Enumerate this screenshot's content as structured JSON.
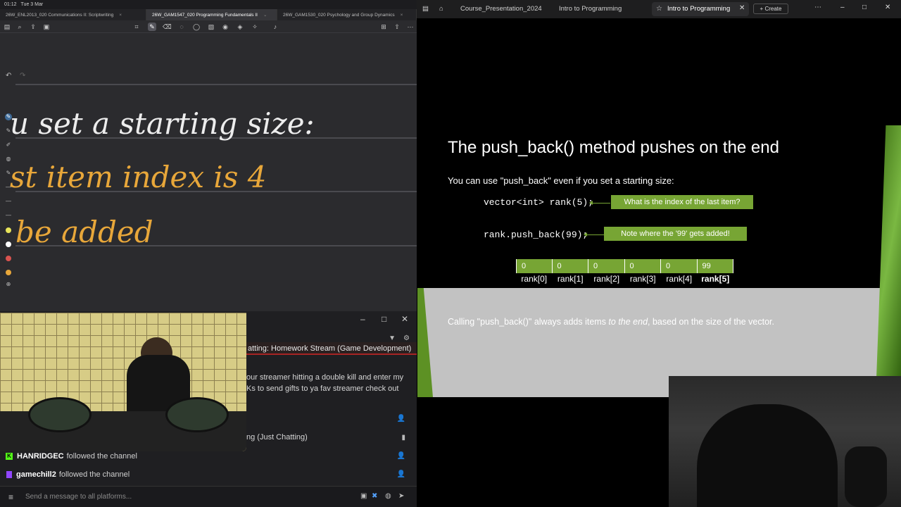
{
  "status": {
    "time": "01:12",
    "date": "Tue 3 Mar"
  },
  "notebook": {
    "tabs": [
      {
        "label": "26W_ENL2013_020 Communications II: Scriptwriting"
      },
      {
        "label": "26W_GAM1547_020 Programming Fundamentals II",
        "active": true
      },
      {
        "label": "26W_GAM1530_020 Psychology and Group Dynamics"
      }
    ],
    "handwriting": [
      {
        "text": "u set a starting size:",
        "color": "white"
      },
      {
        "text": "st item index is 4",
        "color": "orange"
      },
      {
        "text": "be added",
        "color": "orange"
      }
    ]
  },
  "chat": {
    "banner": "atting: Homework Stream (Game Development)",
    "lines": [
      "our streamer hitting a double kill and enter my",
      "Ks to send gifts to ya fav streamer check out",
      "ng (Just Chatting)"
    ],
    "follows": [
      {
        "name": "HANRIDGEC",
        "action": "followed the channel",
        "platform": "kick"
      },
      {
        "name": "gamechill2",
        "action": "followed the channel",
        "platform": "twitch"
      }
    ],
    "input_placeholder": "Send a message to all platforms..."
  },
  "browser": {
    "tabs": [
      {
        "label": "Course_Presentation_2024"
      },
      {
        "label": "Intro to Programming"
      },
      {
        "label": "Intro to Programming",
        "active": true
      }
    ],
    "create_label": "+ Create"
  },
  "slide": {
    "title": "The push_back() method pushes on the end",
    "subtitle": "You can use \"push_back\" even if you set a starting size:",
    "code1": "vector<int> rank(5);",
    "callout1": "What is the index of the last item?",
    "code2": "rank.push_back(99);",
    "callout2": "Note where the '99' gets added!",
    "cells": [
      "0",
      "0",
      "0",
      "0",
      "0",
      "99"
    ],
    "labels": [
      "rank[0]",
      "rank[1]",
      "rank[2]",
      "rank[3]",
      "rank[4]",
      "rank[5]"
    ],
    "note_pre": "Calling \"push_back()\" always adds items ",
    "note_em": "to the end",
    "note_post": ", based on the size of the vector."
  },
  "colors": {
    "accent_green": "#77a534",
    "handwriting_orange": "#e8a73a"
  }
}
